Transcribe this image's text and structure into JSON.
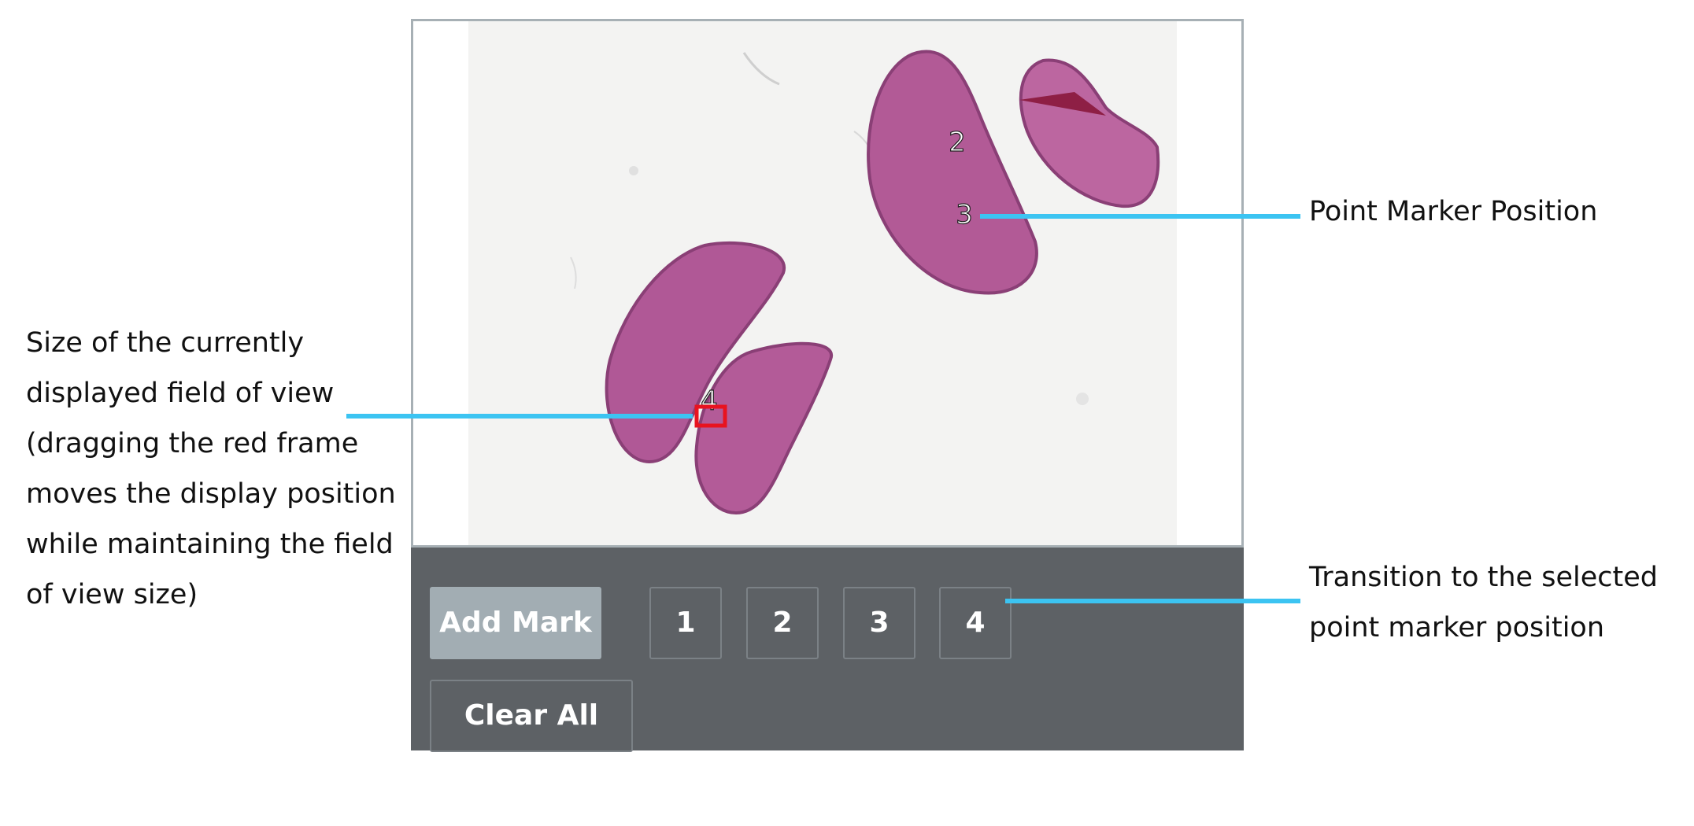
{
  "viewer": {
    "markers": [
      "2",
      "3",
      "4"
    ]
  },
  "controls": {
    "add_mark_label": "Add Mark",
    "mark_buttons": [
      "1",
      "2",
      "3",
      "4"
    ],
    "clear_all_label": "Clear All"
  },
  "annotations": {
    "point_marker": "Point Marker Position",
    "field_of_view": [
      "Size of the currently",
      "displayed field of view",
      "(dragging the red frame",
      "moves the display position",
      "while maintaining the field",
      "of view size)"
    ],
    "transition": [
      "Transition to the selected",
      "point marker position"
    ]
  },
  "colors": {
    "panel": "#5d6165",
    "viewer_border": "#a7b0b5",
    "button_primary": "#a2adb3",
    "callout": "#3cc4f2",
    "tissue": "#b25a96",
    "red_frame": "#e8131f"
  }
}
